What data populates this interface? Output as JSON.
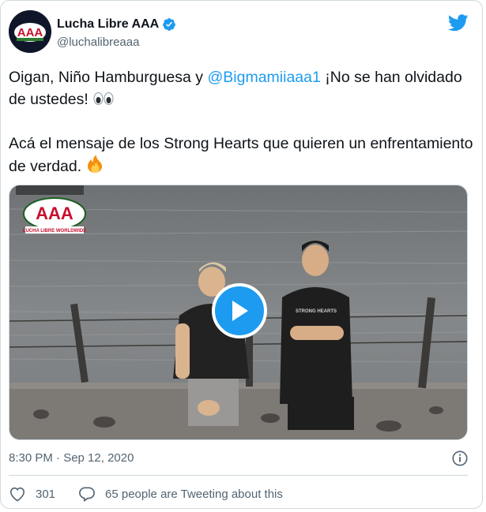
{
  "author": {
    "display_name": "Lucha Libre AAA",
    "handle": "@luchalibreaaa",
    "verified": true,
    "avatar_logo_text": "AAA"
  },
  "tweet": {
    "line1_pre": "Oigan, Niño Hamburguesa y ",
    "mention": "@Bigmamiiaaa1",
    "line1_post": " ¡No se han olvidado de ustedes!",
    "line1_emoji": "eyes-emoji",
    "line2": "Acá el mensaje de los Strong Hearts que quieren un enfrentamiento de verdad.",
    "line2_emoji": "fire-emoji"
  },
  "media": {
    "type": "video",
    "watermark_text": "AAA",
    "watermark_subtext": "LUCHA LIBRE WORLDWIDE",
    "shirt_text": "STRONG HEARTS"
  },
  "meta": {
    "timestamp": "8:30 PM · Sep 12, 2020"
  },
  "actions": {
    "like_count": "301",
    "reply_text": "65 people are Tweeting about this"
  },
  "colors": {
    "accent": "#1d9bf0",
    "muted": "#536471",
    "border": "#cfd9de",
    "text": "#0f1419"
  },
  "icons": [
    "twitter-bird-icon",
    "verified-badge-icon",
    "play-icon",
    "info-icon",
    "heart-icon",
    "reply-bubble-icon"
  ]
}
